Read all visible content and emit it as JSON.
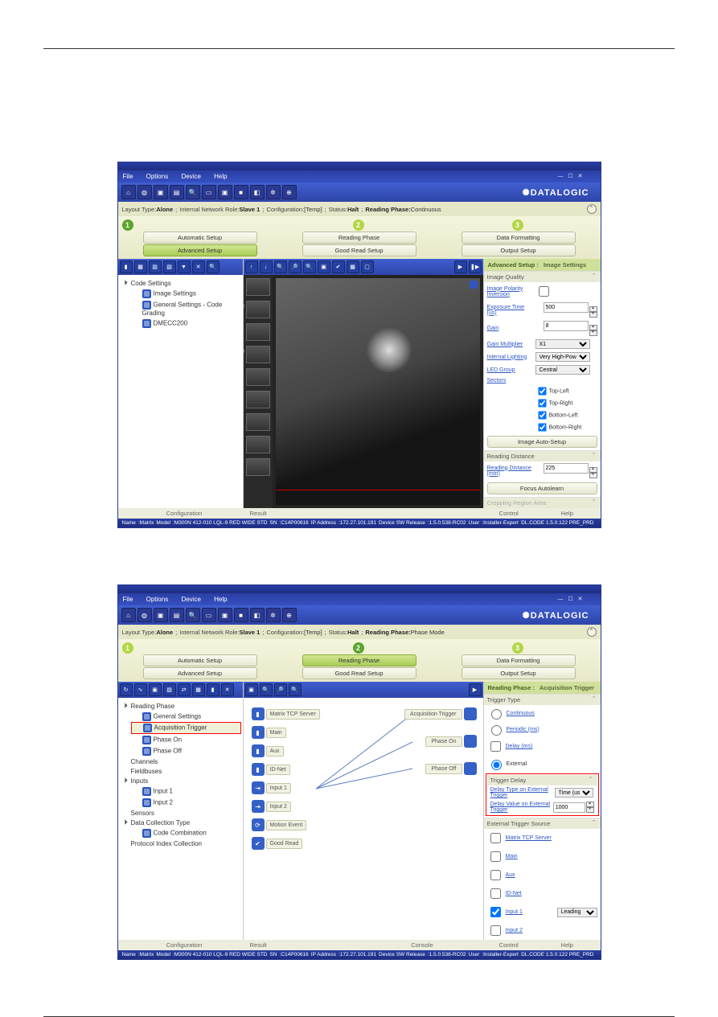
{
  "menu": {
    "file": "File",
    "options": "Options",
    "device": "Device",
    "help": "Help"
  },
  "brand": "DATALOGIC",
  "topstrip1": {
    "layout_type_lbl": "Layout Type",
    "layout_type": "Alone",
    "net_role_lbl": "Internal Network Role",
    "net_role": "Slave 1",
    "config_lbl": "Configuration",
    "config": "[Temp]",
    "status_lbl": "Status",
    "status": "Halt",
    "rphase_lbl": "Reading Phase:",
    "rphase": "Continuous"
  },
  "steps": {
    "automatic": "Automatic Setup",
    "advanced": "Advanced Setup",
    "reading": "Reading Phase",
    "goodread": "Good Read Setup",
    "dataformat": "Data Formatting",
    "output": "Output Setup"
  },
  "tree1": {
    "root": "Code Settings",
    "image": "Image Settings",
    "general": "General Settings - Code Grading",
    "dm": "DMECC200"
  },
  "bottom": {
    "config": "Configuration",
    "result": "Result",
    "console": "Console",
    "control": "Control",
    "help": "Help"
  },
  "right1": {
    "tab1": "Advanced Setup :",
    "tab2": "Image Settings",
    "sec_iq": "Image Quality",
    "polarity": "Image Polarity Inversion",
    "exposure": "Exposure Time (us)",
    "exposure_v": "500",
    "gain": "Gain",
    "gain_v": "8",
    "gainmul": "Gain Multiplier",
    "gainmul_v": "X1",
    "intlight": "Internal Lighting",
    "intlight_v": "Very High-Power Strobed",
    "ledgroup": "LED Group",
    "ledgroup_v": "Central",
    "sectors": "Sectors",
    "tl": "Top-Left",
    "tr": "Top-Right",
    "bl": "Bottom-Left",
    "br": "Bottom-Right",
    "autobtn": "Image Auto-Setup",
    "sec_rd": "Reading Distance",
    "rdist": "Reading Distance (mm)",
    "rdist_v": "225",
    "focusbtn": "Focus Autolearn",
    "sec_crop": "Cropping Region Area"
  },
  "status1": {
    "name_l": "Name",
    "name": "Matrix",
    "model_l": "Model",
    "model": "M300N 412-010 LQL-9 RED WIDE STD",
    "sn_l": "SN",
    "sn": "C14P00616",
    "ip_l": "IP Address",
    "ip": "172.27.101.191",
    "sw_l": "Device SW Release",
    "sw": "1.5.0.538-RC02",
    "user_l": "User",
    "user": "Installer-Expert",
    "ver": "DL.CODE 1.5.0.122 PRE_PRD"
  },
  "topstrip2": {
    "rphase": "Phase Mode"
  },
  "right2": {
    "tab1": "Reading Phase :",
    "tab2": "Acquisition Trigger",
    "sec_tt": "Trigger Type",
    "continuous": "Continuous",
    "periodic": "Periodic (ms)",
    "delay": "Delay (ms)",
    "external": "External",
    "sec_td": "Trigger Delay",
    "dtype": "Delay Type on External Trigger",
    "dtype_v": "Time (us)",
    "dval": "Delay Value on External Trigger",
    "dval_v": "1000",
    "sec_ets": "External Trigger Source",
    "m_tcp": "Matrix TCP Server",
    "m_main": "Main",
    "m_aux": "Aux",
    "m_idnet": "ID-Net",
    "m_in1": "Input 1",
    "leading": "Leading",
    "m_in2": "Input 2"
  },
  "tree2": {
    "root": "Reading Phase",
    "gs": "General Settings",
    "at": "Acquisition Trigger",
    "pon": "Phase On",
    "poff": "Phase Off",
    "channels": "Channels",
    "fieldbuses": "Fieldbuses",
    "inputs": "Inputs",
    "in1": "Input 1",
    "in2": "Input 2",
    "sensors": "Sensors",
    "dct": "Data Collection Type",
    "cc": "Code Combination",
    "pic": "Protocol Index Collection"
  },
  "diagram": {
    "tcp": "Matrix TCP Server",
    "main": "Main",
    "aux": "Aux",
    "idnet": "ID-Net",
    "in1": "Input 1",
    "in2": "Input 2",
    "motion": "Motion Event",
    "goodread": "Good Read",
    "atrig": "Acquisition Trigger",
    "pon": "Phase On",
    "poff": "Phase Off"
  }
}
